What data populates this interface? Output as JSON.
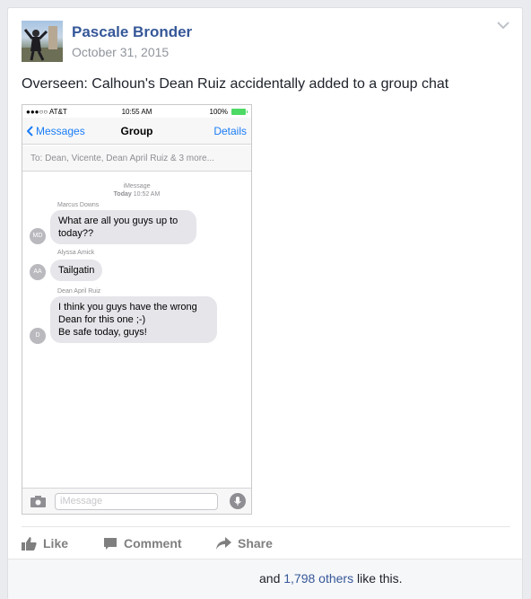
{
  "post": {
    "author": "Pascale Bronder",
    "date": "October 31, 2015",
    "text": "Overseen: Calhoun's Dean Ruiz accidentally added to a group chat"
  },
  "phone": {
    "status": {
      "carrier": "●●●○○ AT&T",
      "time": "10:55 AM",
      "battery": "100%"
    },
    "nav": {
      "back": "Messages",
      "title": "Group",
      "details": "Details"
    },
    "to": "To: Dean, Vicente, Dean April Ruiz & 3 more...",
    "thread_header": {
      "service": "iMessage",
      "when_prefix": "Today",
      "when_time": "10:52 AM"
    },
    "messages": [
      {
        "sender": "Marcus Downs",
        "initials": "MD",
        "lines": [
          "What are all you guys up to",
          "today??"
        ]
      },
      {
        "sender": "Alyssa Amick",
        "initials": "AA",
        "lines": [
          "Tailgatin"
        ]
      },
      {
        "sender": "Dean April Ruiz",
        "initials": "D",
        "lines": [
          "I think you guys have the wrong",
          "Dean for this one ;-)",
          "Be safe today, guys!"
        ]
      }
    ],
    "input_placeholder": "iMessage"
  },
  "actions": {
    "like": "Like",
    "comment": "Comment",
    "share": "Share"
  },
  "likes": {
    "prefix": "and",
    "count_link": "1,798 others",
    "suffix": "like this."
  },
  "colors": {
    "link": "#365899",
    "ios_blue": "#1a7cf5",
    "bubble": "#e5e5ea"
  }
}
